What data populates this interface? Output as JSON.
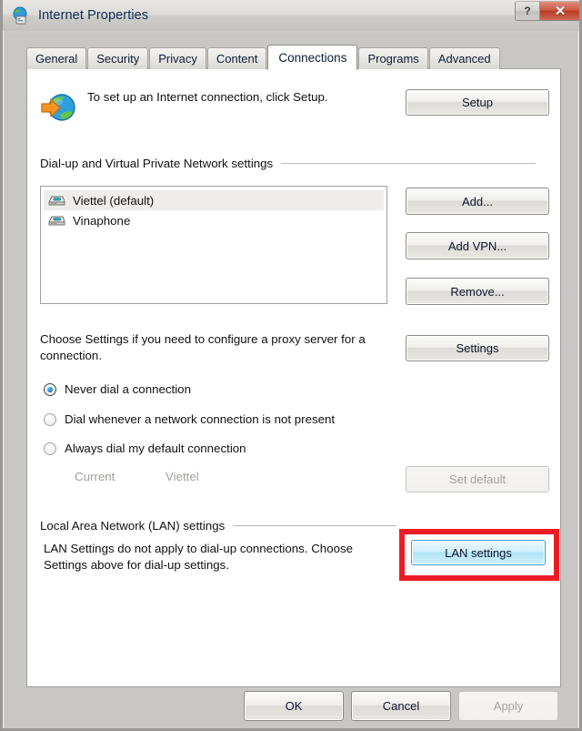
{
  "window": {
    "title": "Internet Properties",
    "icon": "internet-properties-icon",
    "help_button": "?",
    "close_button": "✕"
  },
  "tabs": [
    {
      "label": "General",
      "active": false
    },
    {
      "label": "Security",
      "active": false
    },
    {
      "label": "Privacy",
      "active": false
    },
    {
      "label": "Content",
      "active": false
    },
    {
      "label": "Connections",
      "active": true
    },
    {
      "label": "Programs",
      "active": false
    },
    {
      "label": "Advanced",
      "active": false
    }
  ],
  "intro": {
    "icon": "globe-with-arrow-icon",
    "text": "To set up an Internet connection, click Setup.",
    "setup_button": "Setup"
  },
  "dialup_group": {
    "header": "Dial-up and Virtual Private Network settings",
    "items": [
      {
        "icon": "modem-icon",
        "label": "Viettel (default)",
        "selected": true
      },
      {
        "icon": "modem-icon",
        "label": "Vinaphone",
        "selected": false
      }
    ],
    "buttons": {
      "add": "Add...",
      "add_vpn": "Add VPN...",
      "remove": "Remove...",
      "settings": "Settings"
    }
  },
  "proxy": {
    "text": "Choose Settings if you need to configure a proxy server for a connection."
  },
  "dial_options": [
    {
      "label": "Never dial a connection",
      "selected": true
    },
    {
      "label": "Dial whenever a network connection is not present",
      "selected": false
    },
    {
      "label": "Always dial my default connection",
      "selected": false
    }
  ],
  "current": {
    "label": "Current",
    "value": "Viettel",
    "set_default_button": "Set default",
    "disabled": true
  },
  "lan_group": {
    "header": "Local Area Network (LAN) settings",
    "text": "LAN Settings do not apply to dial-up connections. Choose Settings above for dial-up settings.",
    "lan_settings_button": "LAN settings",
    "highlight_color": "#ec1c24",
    "hover_color": "#3c9fd4"
  },
  "footer": {
    "ok": "OK",
    "cancel": "Cancel",
    "apply": "Apply",
    "apply_disabled": true
  }
}
